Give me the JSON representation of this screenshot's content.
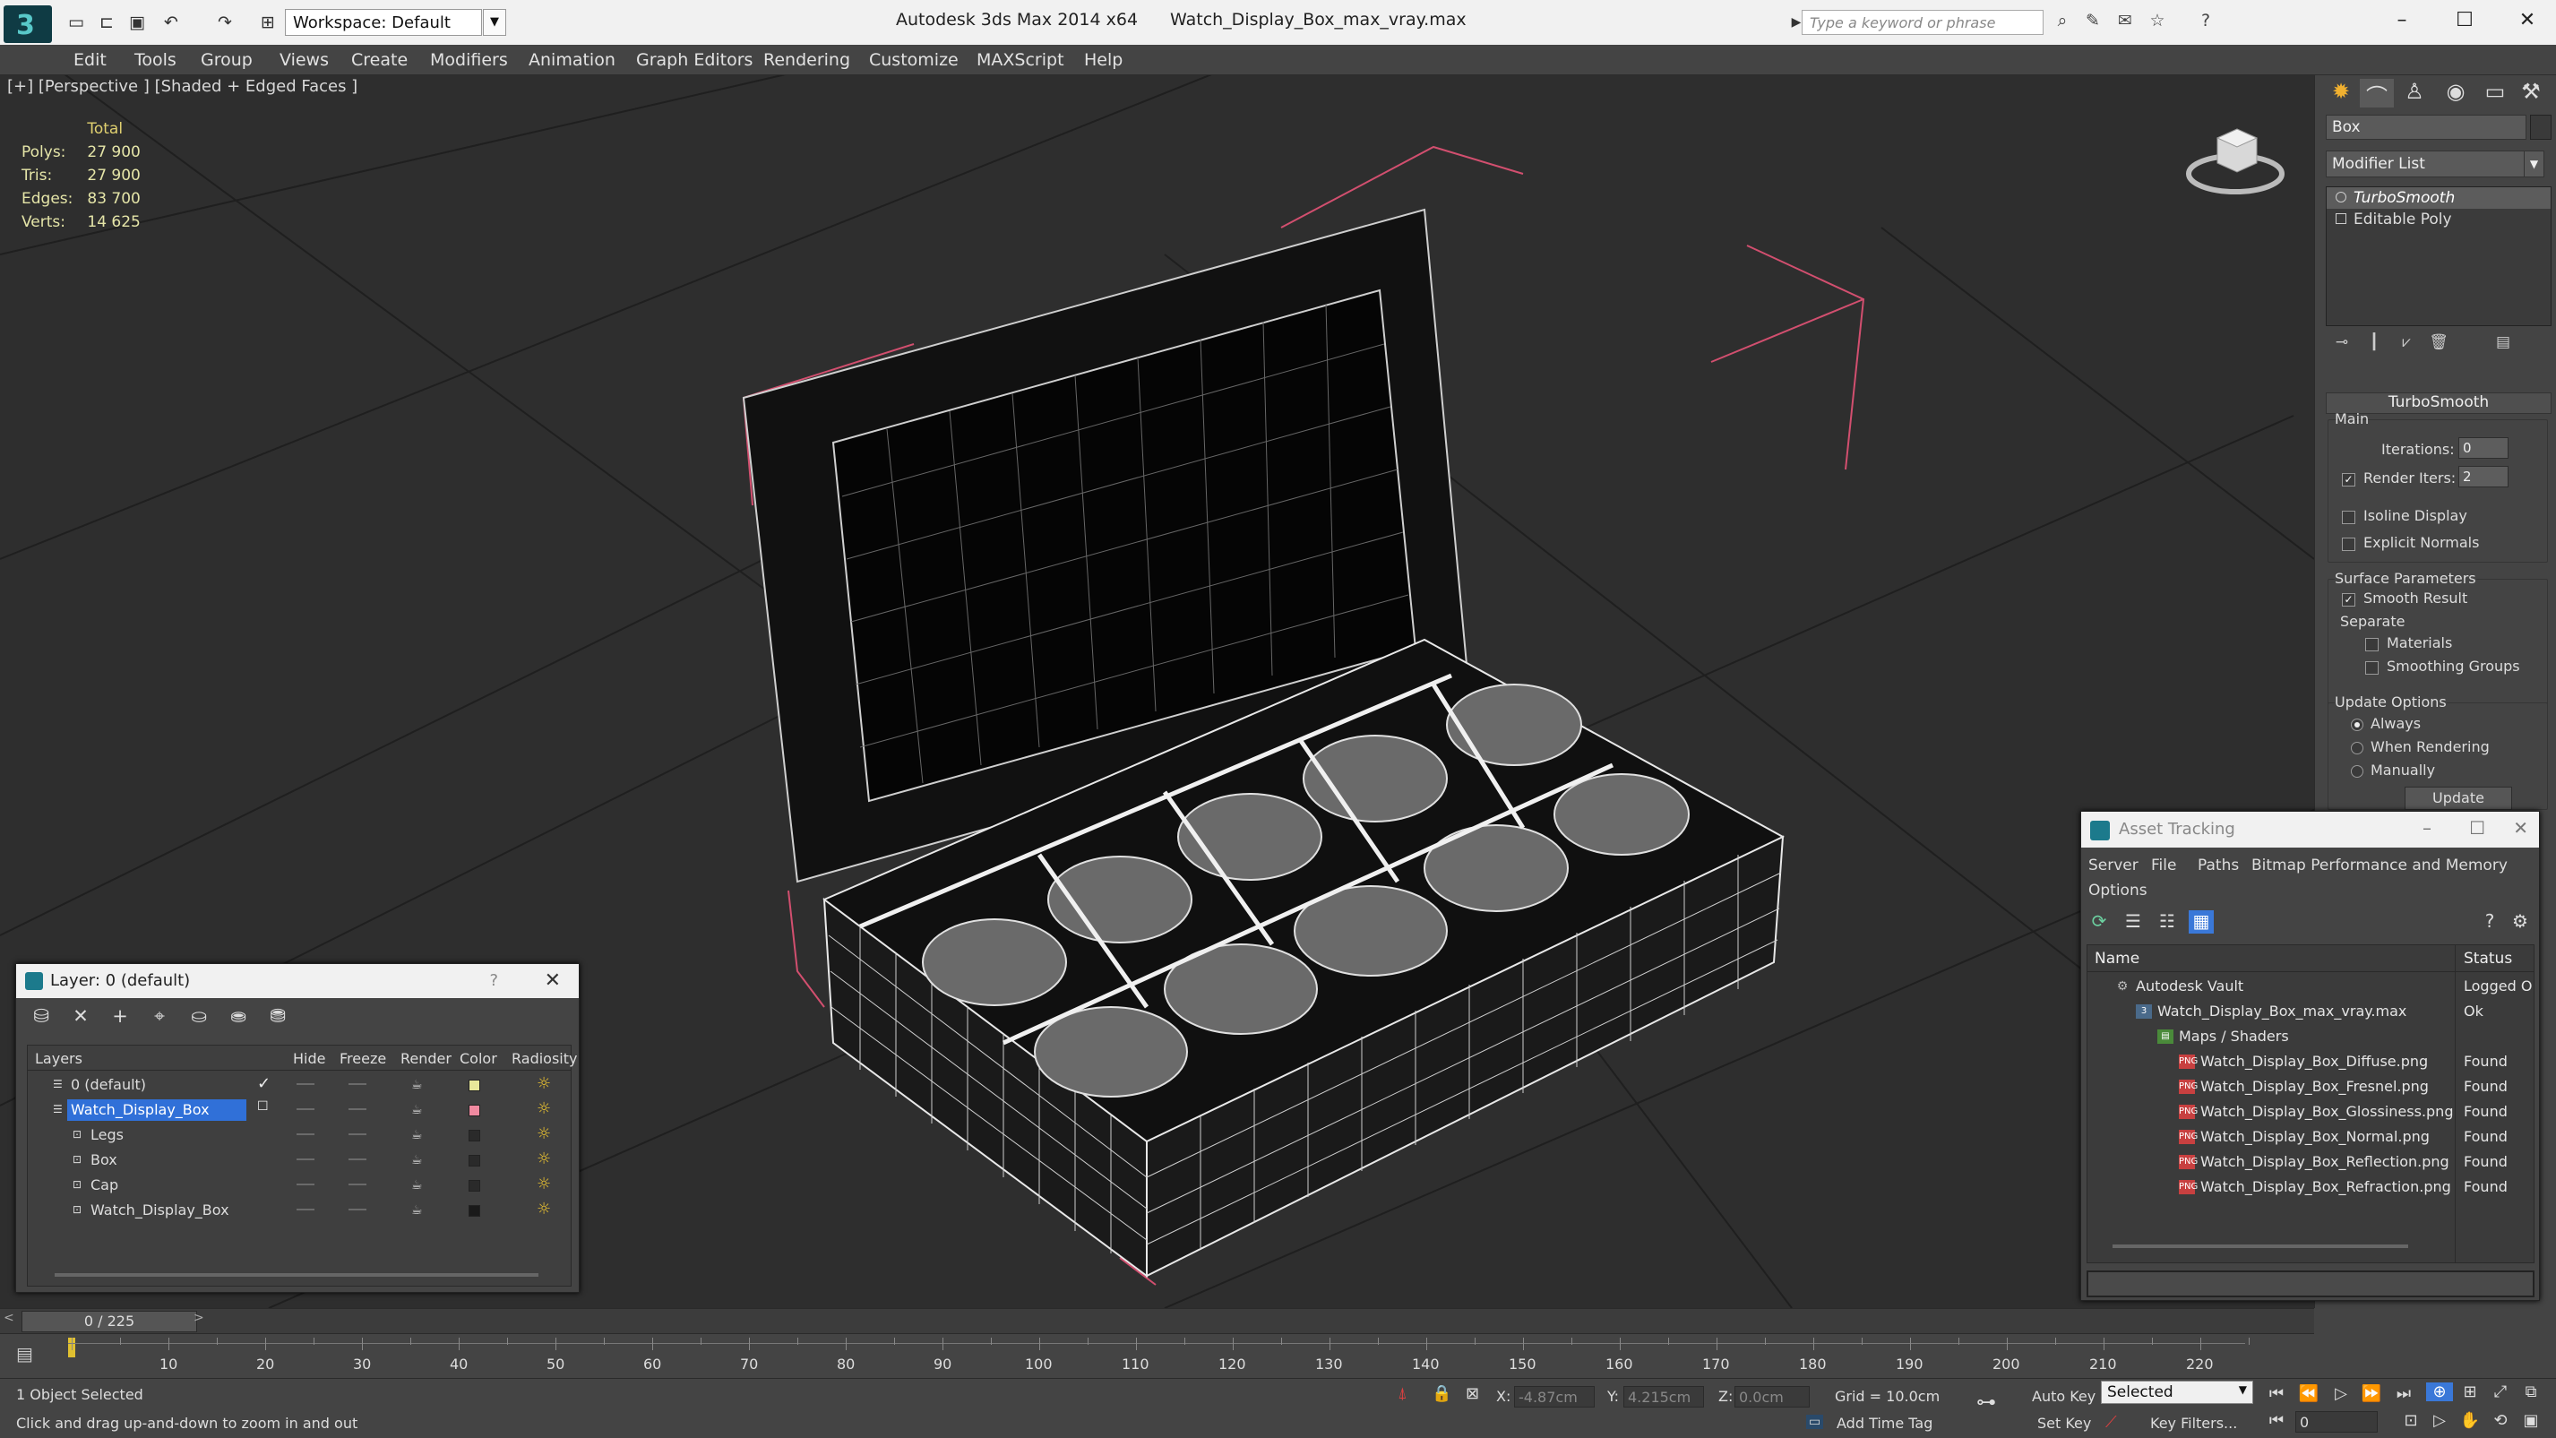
{
  "titlebar": {
    "workspace": "Workspace: Default",
    "app": "Autodesk 3ds Max  2014 x64",
    "file": "Watch_Display_Box_max_vray.max",
    "search_placeholder": "Type a keyword or phrase"
  },
  "menu": [
    "Edit",
    "Tools",
    "Group",
    "Views",
    "Create",
    "Modifiers",
    "Animation",
    "Graph Editors",
    "Rendering",
    "Customize",
    "MAXScript",
    "Help"
  ],
  "viewport": {
    "label": "[+] [Perspective ] [Shaded + Edged Faces ]",
    "stats": {
      "header": "Total",
      "rows": [
        {
          "k": "Polys:",
          "v": "27 900"
        },
        {
          "k": "Tris:",
          "v": "27 900"
        },
        {
          "k": "Edges:",
          "v": "83 700"
        },
        {
          "k": "Verts:",
          "v": "14 625"
        }
      ]
    }
  },
  "command_panel": {
    "object_name": "Box",
    "modifier_list": "Modifier List",
    "stack": [
      "TurboSmooth",
      "Editable Poly"
    ],
    "rollout": "TurboSmooth",
    "main": "Main",
    "iterations_label": "Iterations:",
    "iterations": "0",
    "render_iters_label": "Render Iters:",
    "render_iters": "2",
    "isoline": "Isoline Display",
    "explicit_normals": "Explicit Normals",
    "surface_params": "Surface Parameters",
    "smooth_result": "Smooth Result",
    "separate": "Separate",
    "materials": "Materials",
    "smoothing_groups": "Smoothing Groups",
    "update_options": "Update Options",
    "always": "Always",
    "when_rendering": "When Rendering",
    "manually": "Manually",
    "update": "Update"
  },
  "layer_window": {
    "title": "Layer: 0 (default)",
    "help": "?",
    "columns": [
      "Layers",
      "Hide",
      "Freeze",
      "Render",
      "Color",
      "Radiosity"
    ],
    "rows": [
      {
        "name": "0 (default)",
        "color": "#e8e89a"
      },
      {
        "name": "Watch_Display_Box",
        "color": "#f08aa0"
      },
      {
        "name": "Legs",
        "color": "#2a2a2a"
      },
      {
        "name": "Box",
        "color": "#2a2a2a"
      },
      {
        "name": "Cap",
        "color": "#2a2a2a"
      },
      {
        "name": "Watch_Display_Box",
        "color": "#1a1a1a"
      }
    ]
  },
  "asset_window": {
    "title": "Asset Tracking",
    "menu": [
      "Server",
      "File",
      "Paths",
      "Bitmap Performance and Memory",
      "Options"
    ],
    "columns": [
      "Name",
      "Status"
    ],
    "rows": [
      {
        "name": "Autodesk Vault",
        "status": "Logged O"
      },
      {
        "name": "Watch_Display_Box_max_vray.max",
        "status": "Ok"
      },
      {
        "name": "Maps / Shaders",
        "status": ""
      },
      {
        "name": "Watch_Display_Box_Diffuse.png",
        "status": "Found"
      },
      {
        "name": "Watch_Display_Box_Fresnel.png",
        "status": "Found"
      },
      {
        "name": "Watch_Display_Box_Glossiness.png",
        "status": "Found"
      },
      {
        "name": "Watch_Display_Box_Normal.png",
        "status": "Found"
      },
      {
        "name": "Watch_Display_Box_Reflection.png",
        "status": "Found"
      },
      {
        "name": "Watch_Display_Box_Refraction.png",
        "status": "Found"
      }
    ]
  },
  "timeline": {
    "frame": "0 / 225",
    "ticks": [
      "10",
      "20",
      "30",
      "40",
      "50",
      "60",
      "70",
      "80",
      "90",
      "100",
      "110",
      "120",
      "130",
      "140",
      "150",
      "160",
      "170",
      "180",
      "190",
      "200",
      "210",
      "220"
    ]
  },
  "status": {
    "selection": "1 Object Selected",
    "prompt": "Click and drag up-and-down to zoom in and out",
    "x_label": "X:",
    "x": "-4.87cm",
    "y_label": "Y:",
    "y": "4.215cm",
    "z_label": "Z:",
    "z": "0.0cm",
    "grid": "Grid = 10.0cm",
    "auto_key": "Auto Key",
    "selected": "Selected",
    "set_key": "Set Key",
    "key_filters": "Key Filters...",
    "add_time_tag": "Add Time Tag",
    "frame_field": "0"
  }
}
